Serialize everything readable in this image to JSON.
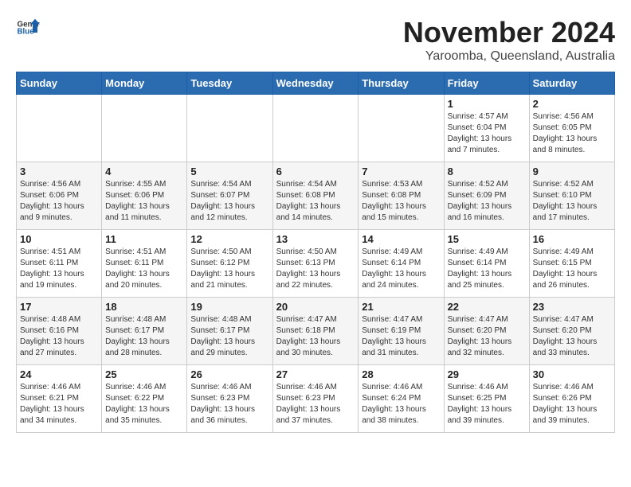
{
  "logo": {
    "general": "General",
    "blue": "Blue"
  },
  "title": "November 2024",
  "location": "Yaroomba, Queensland, Australia",
  "weekdays": [
    "Sunday",
    "Monday",
    "Tuesday",
    "Wednesday",
    "Thursday",
    "Friday",
    "Saturday"
  ],
  "weeks": [
    [
      {
        "day": "",
        "info": ""
      },
      {
        "day": "",
        "info": ""
      },
      {
        "day": "",
        "info": ""
      },
      {
        "day": "",
        "info": ""
      },
      {
        "day": "",
        "info": ""
      },
      {
        "day": "1",
        "info": "Sunrise: 4:57 AM\nSunset: 6:04 PM\nDaylight: 13 hours and 7 minutes."
      },
      {
        "day": "2",
        "info": "Sunrise: 4:56 AM\nSunset: 6:05 PM\nDaylight: 13 hours and 8 minutes."
      }
    ],
    [
      {
        "day": "3",
        "info": "Sunrise: 4:56 AM\nSunset: 6:06 PM\nDaylight: 13 hours and 9 minutes."
      },
      {
        "day": "4",
        "info": "Sunrise: 4:55 AM\nSunset: 6:06 PM\nDaylight: 13 hours and 11 minutes."
      },
      {
        "day": "5",
        "info": "Sunrise: 4:54 AM\nSunset: 6:07 PM\nDaylight: 13 hours and 12 minutes."
      },
      {
        "day": "6",
        "info": "Sunrise: 4:54 AM\nSunset: 6:08 PM\nDaylight: 13 hours and 14 minutes."
      },
      {
        "day": "7",
        "info": "Sunrise: 4:53 AM\nSunset: 6:08 PM\nDaylight: 13 hours and 15 minutes."
      },
      {
        "day": "8",
        "info": "Sunrise: 4:52 AM\nSunset: 6:09 PM\nDaylight: 13 hours and 16 minutes."
      },
      {
        "day": "9",
        "info": "Sunrise: 4:52 AM\nSunset: 6:10 PM\nDaylight: 13 hours and 17 minutes."
      }
    ],
    [
      {
        "day": "10",
        "info": "Sunrise: 4:51 AM\nSunset: 6:11 PM\nDaylight: 13 hours and 19 minutes."
      },
      {
        "day": "11",
        "info": "Sunrise: 4:51 AM\nSunset: 6:11 PM\nDaylight: 13 hours and 20 minutes."
      },
      {
        "day": "12",
        "info": "Sunrise: 4:50 AM\nSunset: 6:12 PM\nDaylight: 13 hours and 21 minutes."
      },
      {
        "day": "13",
        "info": "Sunrise: 4:50 AM\nSunset: 6:13 PM\nDaylight: 13 hours and 22 minutes."
      },
      {
        "day": "14",
        "info": "Sunrise: 4:49 AM\nSunset: 6:14 PM\nDaylight: 13 hours and 24 minutes."
      },
      {
        "day": "15",
        "info": "Sunrise: 4:49 AM\nSunset: 6:14 PM\nDaylight: 13 hours and 25 minutes."
      },
      {
        "day": "16",
        "info": "Sunrise: 4:49 AM\nSunset: 6:15 PM\nDaylight: 13 hours and 26 minutes."
      }
    ],
    [
      {
        "day": "17",
        "info": "Sunrise: 4:48 AM\nSunset: 6:16 PM\nDaylight: 13 hours and 27 minutes."
      },
      {
        "day": "18",
        "info": "Sunrise: 4:48 AM\nSunset: 6:17 PM\nDaylight: 13 hours and 28 minutes."
      },
      {
        "day": "19",
        "info": "Sunrise: 4:48 AM\nSunset: 6:17 PM\nDaylight: 13 hours and 29 minutes."
      },
      {
        "day": "20",
        "info": "Sunrise: 4:47 AM\nSunset: 6:18 PM\nDaylight: 13 hours and 30 minutes."
      },
      {
        "day": "21",
        "info": "Sunrise: 4:47 AM\nSunset: 6:19 PM\nDaylight: 13 hours and 31 minutes."
      },
      {
        "day": "22",
        "info": "Sunrise: 4:47 AM\nSunset: 6:20 PM\nDaylight: 13 hours and 32 minutes."
      },
      {
        "day": "23",
        "info": "Sunrise: 4:47 AM\nSunset: 6:20 PM\nDaylight: 13 hours and 33 minutes."
      }
    ],
    [
      {
        "day": "24",
        "info": "Sunrise: 4:46 AM\nSunset: 6:21 PM\nDaylight: 13 hours and 34 minutes."
      },
      {
        "day": "25",
        "info": "Sunrise: 4:46 AM\nSunset: 6:22 PM\nDaylight: 13 hours and 35 minutes."
      },
      {
        "day": "26",
        "info": "Sunrise: 4:46 AM\nSunset: 6:23 PM\nDaylight: 13 hours and 36 minutes."
      },
      {
        "day": "27",
        "info": "Sunrise: 4:46 AM\nSunset: 6:23 PM\nDaylight: 13 hours and 37 minutes."
      },
      {
        "day": "28",
        "info": "Sunrise: 4:46 AM\nSunset: 6:24 PM\nDaylight: 13 hours and 38 minutes."
      },
      {
        "day": "29",
        "info": "Sunrise: 4:46 AM\nSunset: 6:25 PM\nDaylight: 13 hours and 39 minutes."
      },
      {
        "day": "30",
        "info": "Sunrise: 4:46 AM\nSunset: 6:26 PM\nDaylight: 13 hours and 39 minutes."
      }
    ]
  ]
}
